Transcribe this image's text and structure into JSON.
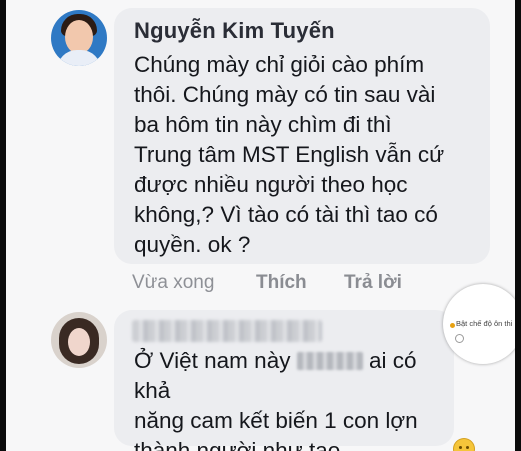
{
  "comments": [
    {
      "author": "Nguyễn Kim Tuyến",
      "lines": [
        "Chúng mày chỉ giỏi cào phím",
        "thôi. Chúng mày có tin sau vài",
        "ba hôm tin này chìm đi thì",
        "Trung tâm MST English vẫn cứ",
        "được nhiều người theo học",
        "không,? Vì tào có tài thì tao có",
        "quyền. ok ?"
      ],
      "actions": {
        "time": "Vừa xong",
        "like": "Thích",
        "reply": "Trả lời"
      }
    },
    {
      "author": "",
      "line1_before": "Ở Việt nam này",
      "line1_after": "ai có khả",
      "lines_rest": [
        "năng cam kết biến 1 con lợn",
        "thành người như tao .."
      ]
    }
  ],
  "mode_toggle": {
    "label": "Bật chế độ ôn thi",
    "dot_color": "#e7a112"
  },
  "icons": [
    "avatar",
    "toggle-status-icon",
    "emoji-reaction-icon"
  ]
}
